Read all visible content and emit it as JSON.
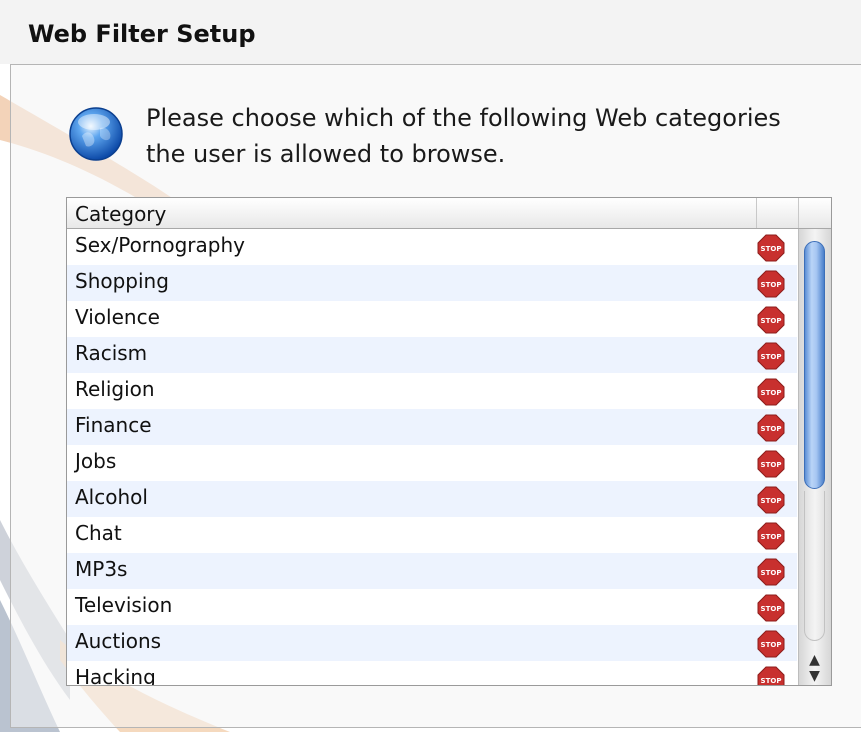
{
  "window": {
    "title": "Web Filter Setup"
  },
  "instructions": {
    "line1": "Please choose which of the following Web categories",
    "line2": "the user is allowed to browse.",
    "icon": "globe-icon"
  },
  "table": {
    "header": {
      "category": "Category"
    },
    "rows": [
      {
        "label": "Sex/Pornography",
        "status_icon": "stop-icon"
      },
      {
        "label": "Shopping",
        "status_icon": "stop-icon"
      },
      {
        "label": "Violence",
        "status_icon": "stop-icon"
      },
      {
        "label": "Racism",
        "status_icon": "stop-icon"
      },
      {
        "label": "Religion",
        "status_icon": "stop-icon"
      },
      {
        "label": "Finance",
        "status_icon": "stop-icon"
      },
      {
        "label": "Jobs",
        "status_icon": "stop-icon"
      },
      {
        "label": "Alcohol",
        "status_icon": "stop-icon"
      },
      {
        "label": "Chat",
        "status_icon": "stop-icon"
      },
      {
        "label": "MP3s",
        "status_icon": "stop-icon"
      },
      {
        "label": "Television",
        "status_icon": "stop-icon"
      },
      {
        "label": "Auctions",
        "status_icon": "stop-icon"
      },
      {
        "label": "Hacking",
        "status_icon": "stop-icon"
      }
    ]
  },
  "colors": {
    "stop_red": "#c8302e",
    "row_alt": "#edf3fe",
    "scroll_blue": "#5c8fd6"
  }
}
